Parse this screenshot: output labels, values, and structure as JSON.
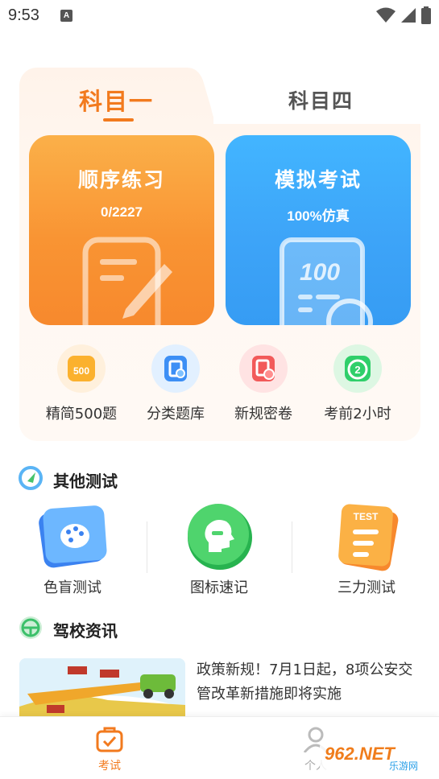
{
  "status_bar": {
    "time": "9:53",
    "notification_icon": "a-icon"
  },
  "tabs": [
    {
      "label": "科目一"
    },
    {
      "label": "科目四"
    }
  ],
  "main_cards": {
    "sequential": {
      "title": "顺序练习",
      "subtitle": "0/2227"
    },
    "mock_exam": {
      "title": "模拟考试",
      "subtitle": "100%仿真",
      "illustration_text": "100"
    }
  },
  "quick_entries": [
    {
      "label": "精简500题",
      "icon": "500-icon",
      "icon_text": "500"
    },
    {
      "label": "分类题库",
      "icon": "category-bank-icon"
    },
    {
      "label": "新规密卷",
      "icon": "secret-paper-icon"
    },
    {
      "label": "考前2小时",
      "icon": "timer-icon",
      "icon_text": "2"
    }
  ],
  "other_tests": {
    "title": "其他测试",
    "items": [
      {
        "label": "色盲测试",
        "icon": "palette-icon"
      },
      {
        "label": "图标速记",
        "icon": "head-icon"
      },
      {
        "label": "三力测试",
        "icon": "test-list-icon",
        "icon_text": "TEST"
      }
    ]
  },
  "news": {
    "title": "驾校资讯",
    "items": [
      {
        "headline": "政策新规！7月1日起，8项公安交管改革新措施即将实施"
      }
    ]
  },
  "bottom_nav": [
    {
      "label": "考试",
      "active": true
    },
    {
      "label": "个人"
    }
  ],
  "watermark": {
    "site": "962.NET",
    "sub": "乐游网"
  },
  "colors": {
    "accent_orange": "#f27a1e",
    "orange_card": "#f99433",
    "blue_card": "#3da4f8"
  }
}
